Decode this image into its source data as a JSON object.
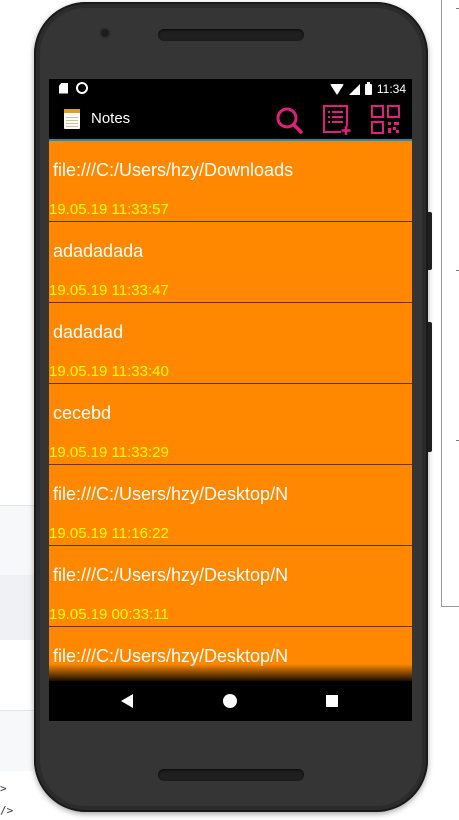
{
  "app": {
    "title": "Notes",
    "accent_color": "#e01f7b",
    "list_background": "#ff8800",
    "title_color": "#ffffff",
    "date_color": "#ffff00"
  },
  "status_bar": {
    "time": "11:34",
    "icons": [
      "sd-card-icon",
      "circle-notification-icon",
      "wifi-icon",
      "signal-icon",
      "battery-icon"
    ]
  },
  "toolbar": {
    "actions": [
      {
        "name": "search-icon"
      },
      {
        "name": "new-note-icon"
      },
      {
        "name": "qr-code-icon"
      }
    ]
  },
  "notes": [
    {
      "title": "file:///C:/Users/hzy/Downloads",
      "date": "19.05.19 11:33:57"
    },
    {
      "title": "adadadada",
      "date": "19.05.19 11:33:47"
    },
    {
      "title": "dadadad",
      "date": "19.05.19 11:33:40"
    },
    {
      "title": "cecebd",
      "date": "19.05.19 11:33:29"
    },
    {
      "title": "file:///C:/Users/hzy/Desktop/N",
      "date": "19.05.19 11:16:22"
    },
    {
      "title": "file:///C:/Users/hzy/Desktop/N",
      "date": "19.05.19 00:33:11"
    },
    {
      "title": "file:///C:/Users/hzy/Desktop/N",
      "date": ""
    }
  ],
  "nav": {
    "buttons": [
      "back-icon",
      "home-icon",
      "recent-apps-icon"
    ]
  },
  "background": {
    "code_line_1": ">",
    "code_line_2": "/>"
  }
}
